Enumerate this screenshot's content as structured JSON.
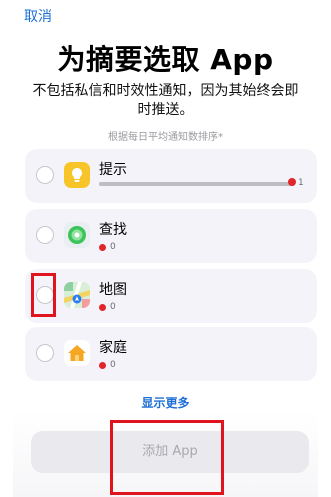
{
  "header": {
    "cancel_label": "取消",
    "title": "为摘要选取 App",
    "subtitle": "不包括私信和时效性通知，因为其始终会即时推送。",
    "sort_note": "根据每日平均通知数排序*"
  },
  "apps": [
    {
      "name": "提示",
      "count": "1",
      "icon": "tips-icon",
      "bar_fraction": 1.0
    },
    {
      "name": "查找",
      "count": "0",
      "icon": "find-my-icon"
    },
    {
      "name": "地图",
      "count": "0",
      "icon": "maps-icon"
    },
    {
      "name": "家庭",
      "count": "0",
      "icon": "home-icon"
    }
  ],
  "show_more_label": "显示更多",
  "add_button_label": "添加 App",
  "colors": {
    "accent": "#1e6fd6",
    "highlight": "#e0141e",
    "count_dot": "#e0262b"
  }
}
